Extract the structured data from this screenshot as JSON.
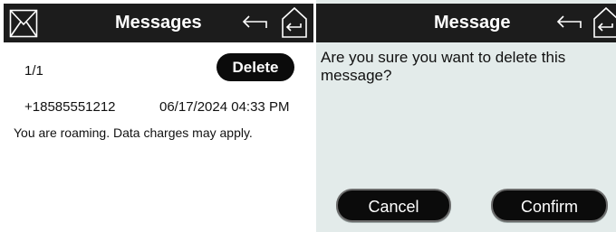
{
  "messages_screen": {
    "header": {
      "title": "Messages"
    },
    "counter": "1/1",
    "delete_label": "Delete",
    "message": {
      "sender": "+18585551212",
      "timestamp": "06/17/2024 04:33 PM",
      "body": "You are roaming. Data charges may apply."
    }
  },
  "confirm_screen": {
    "header": {
      "title": "Message"
    },
    "prompt_line1": "Are you sure you want to delete this",
    "prompt_line2": "message?",
    "cancel_label": "Cancel",
    "confirm_label": "Confirm"
  },
  "icons": {
    "mail": "envelope-icon",
    "back": "back-arrow-icon",
    "home": "home-icon"
  },
  "colors": {
    "header_bg": "#1c1c1c",
    "button_bg": "#0b0b0b",
    "dialog_bg": "#e3ebea"
  }
}
